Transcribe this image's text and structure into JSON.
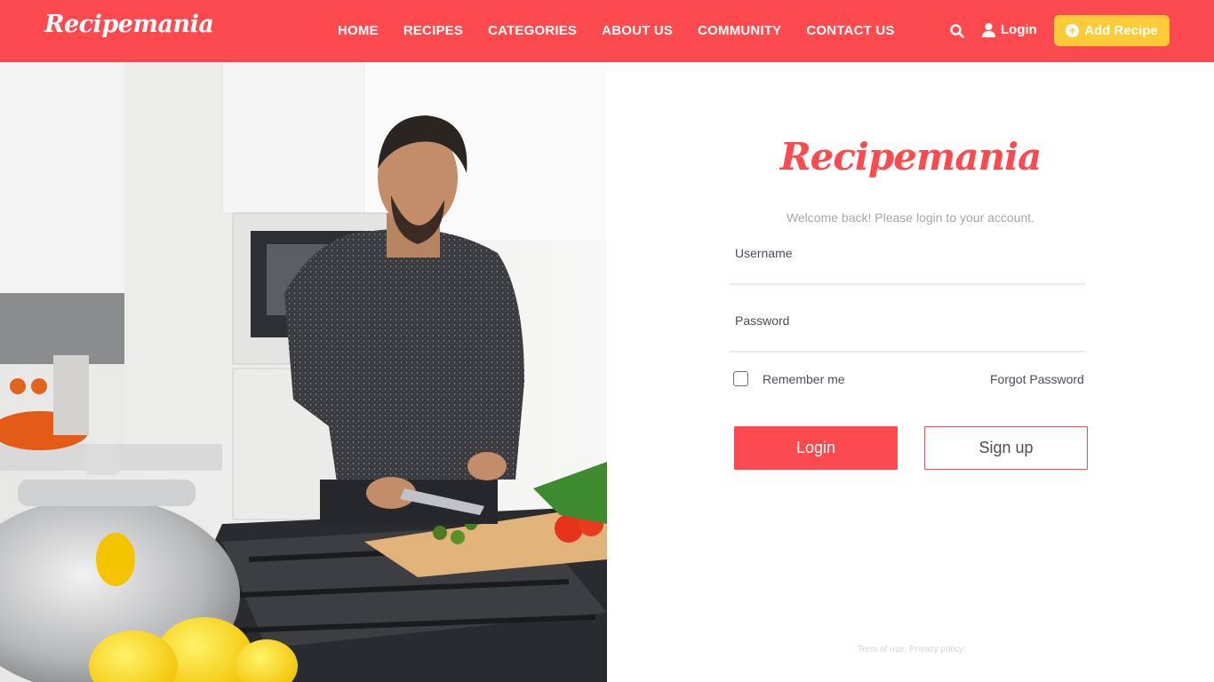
{
  "header": {
    "brand": "Recipemania",
    "nav": [
      "HOME",
      "RECIPES",
      "CATEGORIES",
      "ABOUT US",
      "COMMUNITY",
      "CONTACT US"
    ],
    "search_icon": "search-icon",
    "login_label": "Login",
    "add_recipe_label": "Add Recipe",
    "brand_color": "#fd4a4e",
    "accent_color": "#fdcb38"
  },
  "login_form": {
    "logo": "Recipemania",
    "welcome": "Welcome back! Please login to your account.",
    "username_placeholder": "Username",
    "password_placeholder": "Password",
    "remember_label": "Remember me",
    "forgot_label": "Forgot Password",
    "login_button": "Login",
    "signup_button": "Sign up"
  },
  "footer": {
    "terms": "Term of use.",
    "privacy": "Privacy policy"
  }
}
